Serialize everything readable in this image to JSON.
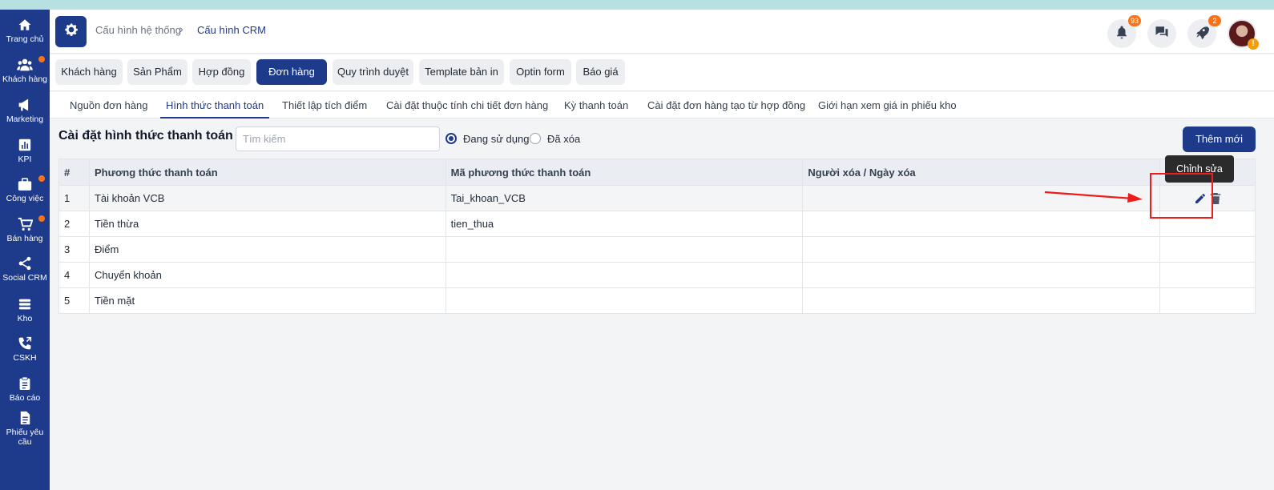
{
  "sidebar": {
    "items": [
      {
        "label": "Trang chủ",
        "icon": "home-icon",
        "dot": false
      },
      {
        "label": "Khách hàng",
        "icon": "users-icon",
        "dot": true
      },
      {
        "label": "Marketing",
        "icon": "megaphone-icon",
        "dot": false
      },
      {
        "label": "KPI",
        "icon": "chart-icon",
        "dot": false
      },
      {
        "label": "Công việc",
        "icon": "briefcase-icon",
        "dot": true
      },
      {
        "label": "Bán hàng",
        "icon": "cart-icon",
        "dot": true
      },
      {
        "label": "Social CRM",
        "icon": "share-icon",
        "dot": false
      },
      {
        "label": "Kho",
        "icon": "stack-icon",
        "dot": false
      },
      {
        "label": "CSKH",
        "icon": "phone-icon",
        "dot": false
      },
      {
        "label": "Báo cáo",
        "icon": "clipboard-icon",
        "dot": false
      },
      {
        "label": "Phiếu yêu cầu",
        "icon": "document-icon",
        "dot": false
      }
    ]
  },
  "header": {
    "breadcrumb": [
      "Cấu hình hệ thống",
      "Cấu hình CRM"
    ],
    "notifications_count": "93",
    "rocket_count": "2"
  },
  "config_tabs": [
    "Khách hàng",
    "Sản Phẩm",
    "Hợp đồng",
    "Đơn hàng",
    "Quy trình duyệt",
    "Template bản in",
    "Optin form",
    "Báo giá"
  ],
  "active_config_tab": "Đơn hàng",
  "sub_tabs": [
    "Nguồn đơn hàng",
    "Hình thức thanh toán",
    "Thiết lập tích điểm",
    "Cài đặt thuộc tính chi tiết đơn hàng",
    "Kỳ thanh toán",
    "Cài đặt đơn hàng tạo từ hợp đồng",
    "Giới hạn xem giá in phiếu kho"
  ],
  "active_sub_tab": "Hình thức thanh toán",
  "page": {
    "title": "Cài đặt hình thức thanh toán",
    "search_placeholder": "Tìm kiếm",
    "search_value": "",
    "filter_options": [
      "Đang sử dụng",
      "Đã xóa"
    ],
    "filter_selected": "Đang sử dụng",
    "add_button": "Thêm mới",
    "tooltip": "Chỉnh sửa"
  },
  "table": {
    "columns": [
      "#",
      "Phương thức thanh toán",
      "Mã phương thức thanh toán",
      "Người xóa / Ngày xóa",
      ""
    ],
    "rows": [
      [
        "1",
        "Tài khoản VCB",
        "Tai_khoan_VCB",
        ""
      ],
      [
        "2",
        "Tiền thừa",
        "tien_thua",
        ""
      ],
      [
        "3",
        "Điểm",
        "",
        ""
      ],
      [
        "4",
        "Chuyển khoản",
        "",
        ""
      ],
      [
        "5",
        "Tiền mặt",
        "",
        ""
      ]
    ]
  },
  "colors": {
    "primary": "#1e3a8a",
    "badge": "#f97316",
    "annotation": "#ef1c1c"
  }
}
